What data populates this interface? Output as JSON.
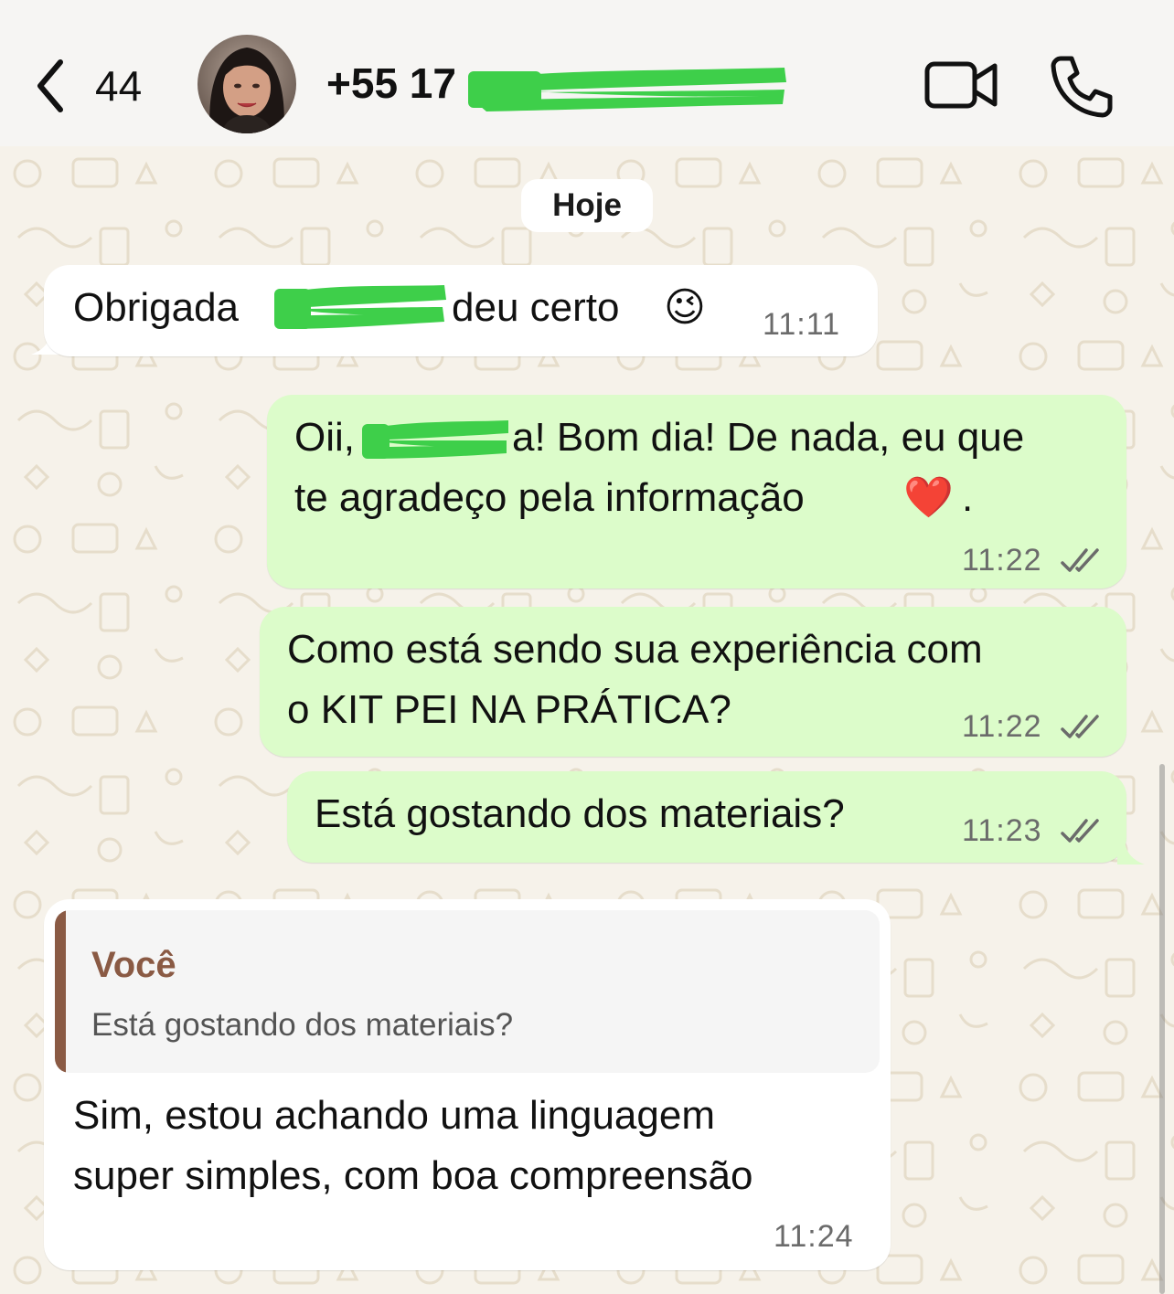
{
  "header": {
    "back_count": "44",
    "contact_name": "+55 17"
  },
  "chat": {
    "date_label": "Hoje",
    "messages": [
      {
        "direction": "incoming",
        "text_before": "Obrigada",
        "text_after": "deu certo",
        "emoji": "😉",
        "time": "11:11"
      },
      {
        "direction": "outgoing",
        "line1_before": "Oii,",
        "line1_after": "a! Bom dia! De nada, eu que",
        "line2": "te agradeço pela informação",
        "emoji": "❤️",
        "line2_end": ".",
        "time": "11:22",
        "status": "read"
      },
      {
        "direction": "outgoing",
        "line1": "Como está sendo sua experiência com",
        "line2": "o KIT PEI NA PRÁTICA?",
        "time": "11:22",
        "status": "read"
      },
      {
        "direction": "outgoing",
        "text": "Está gostando dos materiais?",
        "time": "11:23",
        "status": "read"
      },
      {
        "direction": "incoming",
        "quote": {
          "author": "Você",
          "text": "Está gostando dos materiais?"
        },
        "line1": "Sim, estou achando uma linguagem",
        "line2": "super simples, com boa compreensão",
        "time": "11:24"
      }
    ]
  },
  "colors": {
    "incoming_bubble": "#ffffff",
    "outgoing_bubble": "#dcfcca",
    "chat_background": "#f6f2ea",
    "quote_accent": "#8a5a44",
    "redaction": "#3ecf4a"
  },
  "icons": [
    "chevron-left-icon",
    "video-call-icon",
    "phone-icon",
    "double-check-icon"
  ]
}
